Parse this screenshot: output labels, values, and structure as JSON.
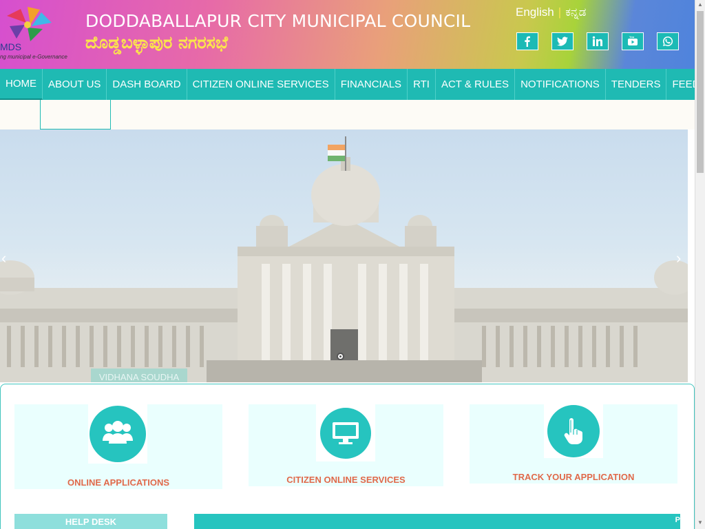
{
  "header": {
    "logo_text": "MDS",
    "logo_tagline": "ng municipal e-Governance",
    "title": "DODDABALLAPUR CITY MUNICIPAL COUNCIL",
    "subtitle": "ದೊಡ್ಡಬಳ್ಳಾಪುರ ನಗರಸಭೆ",
    "lang_english": "English",
    "lang_kannada": "ಕನ್ನಡ",
    "social": [
      "facebook-icon",
      "twitter-icon",
      "linkedin-icon",
      "youtube-icon",
      "whatsapp-icon"
    ]
  },
  "nav": {
    "items": [
      "HOME",
      "ABOUT US",
      "DASH BOARD",
      "CITIZEN ONLINE SERVICES",
      "FINANCIALS",
      "RTI",
      "ACT & RULES",
      "NOTIFICATIONS",
      "TENDERS",
      "FEEDBACK"
    ]
  },
  "hero": {
    "caption": "VIDHANA SOUDHA"
  },
  "services": [
    {
      "label": "ONLINE APPLICATIONS",
      "icon": "users-group-icon"
    },
    {
      "label": "CITIZEN ONLINE SERVICES",
      "icon": "monitor-icon"
    },
    {
      "label": "TRACK YOUR APPLICATION",
      "icon": "pointer-hand-icon"
    }
  ],
  "helpdesk": {
    "label": "HELP DESK"
  },
  "bar2": {
    "label": "P"
  },
  "colors": {
    "teal": "#1fbab3",
    "orange": "#e0694a"
  }
}
